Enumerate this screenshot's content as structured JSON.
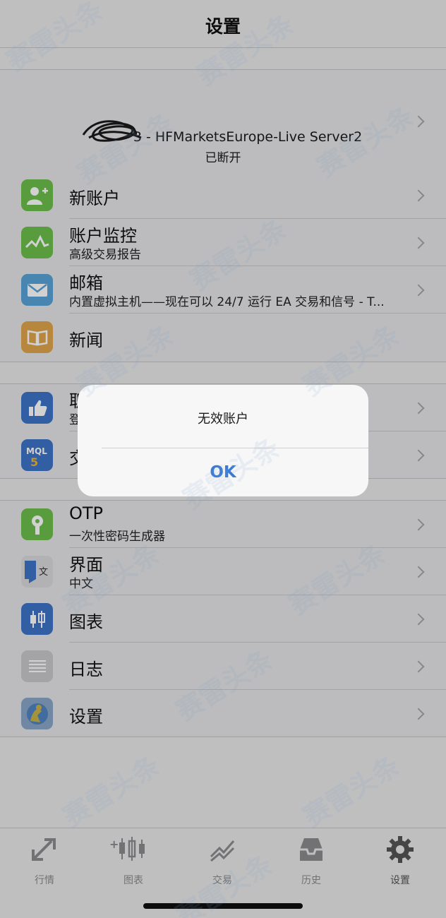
{
  "header": {
    "title": "设置"
  },
  "account": {
    "server": "3 - HFMarketsEurope-Live Server2",
    "status": "已断开"
  },
  "menu_group1": [
    {
      "label": "新账户",
      "icon": "add-user-icon"
    },
    {
      "label": "账户监控",
      "sub": "高级交易报告",
      "icon": "monitor-chart-icon"
    },
    {
      "label": "邮箱",
      "sub": "内置虚拟主机——现在可以 24/7 运行 EA 交易和信号 - T...",
      "icon": "mail-icon"
    },
    {
      "label": "新闻",
      "icon": "book-icon"
    }
  ],
  "menu_group2": [
    {
      "label": "职",
      "sub": "登",
      "icon": "thumbs-up-icon"
    },
    {
      "label": "交",
      "icon": "mql5-icon"
    }
  ],
  "menu_group3": [
    {
      "label": "OTP",
      "sub": "一次性密码生成器",
      "icon": "otp-key-icon"
    },
    {
      "label": "界面",
      "sub": "中文",
      "icon": "language-icon"
    },
    {
      "label": "图表",
      "icon": "candlestick-icon"
    },
    {
      "label": "日志",
      "icon": "journal-icon"
    },
    {
      "label": "设置",
      "icon": "settings-app-icon"
    }
  ],
  "tabs": [
    {
      "label": "行情",
      "icon": "quotes-arrows-icon"
    },
    {
      "label": "图表",
      "icon": "chart-candles-icon"
    },
    {
      "label": "交易",
      "icon": "trade-chart-icon"
    },
    {
      "label": "历史",
      "icon": "inbox-icon"
    },
    {
      "label": "设置",
      "icon": "gear-icon",
      "active": true
    }
  ],
  "alert": {
    "message": "无效账户",
    "ok_label": "OK"
  },
  "watermark": "赛雷头条",
  "colors": {
    "accent": "#3a7bd5",
    "green": "#6cbf4c",
    "orange": "#e0a54b",
    "blue": "#3e74c7"
  }
}
